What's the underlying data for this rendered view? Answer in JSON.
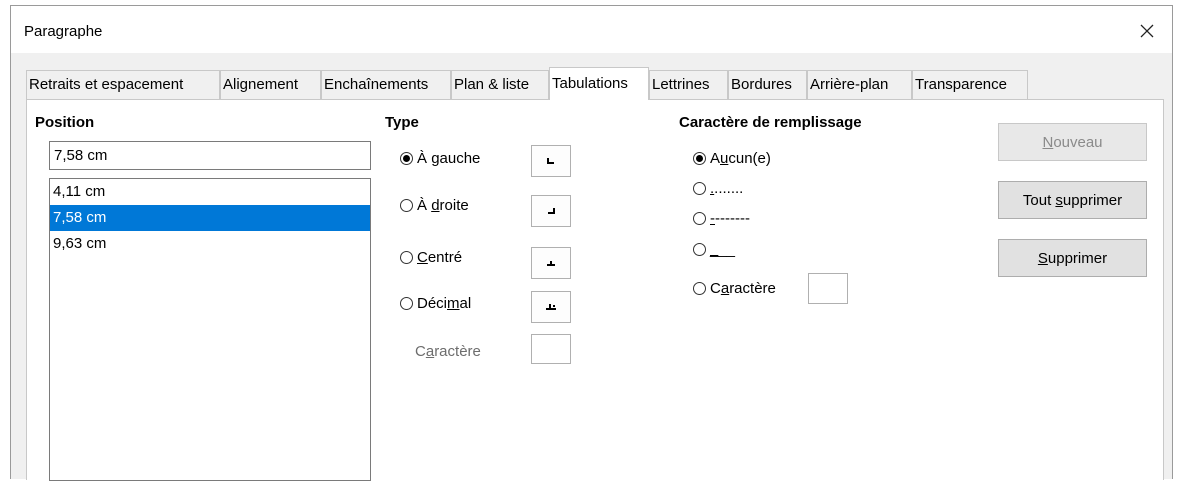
{
  "window": {
    "title": "Paragraphe"
  },
  "tabs": [
    {
      "label": "Retraits et espacement"
    },
    {
      "label": "Alignement"
    },
    {
      "label": "Enchaînements"
    },
    {
      "label": "Plan & liste"
    },
    {
      "label": "Tabulations"
    },
    {
      "label": "Lettrines"
    },
    {
      "label": "Bordures"
    },
    {
      "label": "Arrière-plan"
    },
    {
      "label": "Transparence"
    }
  ],
  "position": {
    "heading": "Position",
    "value": "7,58 cm",
    "list": [
      "4,11 cm",
      "7,58 cm",
      "9,63 cm"
    ],
    "selected": "7,58 cm"
  },
  "type": {
    "heading": "Type",
    "options": [
      {
        "pre": "À ",
        "ul": "g",
        "post": "auche",
        "checked": true
      },
      {
        "pre": "À ",
        "ul": "d",
        "post": "roite",
        "checked": false
      },
      {
        "pre": "",
        "ul": "C",
        "post": "entré",
        "checked": false
      },
      {
        "pre": "Déci",
        "ul": "m",
        "post": "al",
        "checked": false
      }
    ],
    "char_pre": "C",
    "char_ul": "a",
    "char_post": "ractère"
  },
  "fill": {
    "heading": "Caractère de remplissage",
    "options": [
      {
        "pre": "A",
        "ul": "u",
        "post": "cun(e)",
        "checked": true
      },
      {
        "pre": "",
        "ul": ".",
        "post": ".......",
        "checked": false
      },
      {
        "pre": "",
        "ul": "-",
        "post": "-------",
        "checked": false
      },
      {
        "pre": "",
        "ul": "_",
        "post": "__",
        "checked": false
      },
      {
        "pre": "C",
        "ul": "a",
        "post": "ractère",
        "checked": false
      }
    ]
  },
  "buttons": {
    "new": {
      "pre": "",
      "ul": "N",
      "post": "ouveau"
    },
    "delete_all": {
      "pre": "Tout ",
      "ul": "s",
      "post": "upprimer"
    },
    "delete": {
      "pre": "",
      "ul": "S",
      "post": "upprimer"
    }
  }
}
